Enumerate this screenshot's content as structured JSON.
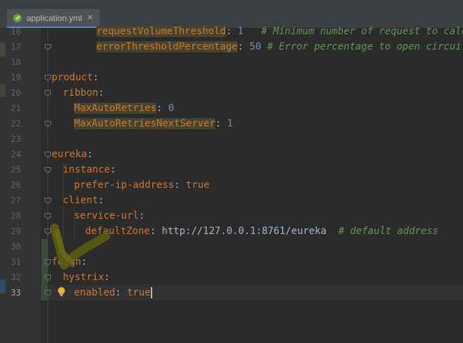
{
  "tab": {
    "filename": "application.yml",
    "close_glyph": "✕",
    "icon": "spring-leaf-icon"
  },
  "colors": {
    "key": "#cc7832",
    "comment": "#629755",
    "number": "#6897bb",
    "text": "#a9b7c6",
    "highlight": "#46432e"
  },
  "lines": [
    {
      "no": "16",
      "key": "requestVolumeThreshold",
      "sep": ": ",
      "value": "1",
      "comment": "   # Minimum number of request to calculo"
    },
    {
      "no": "17",
      "key": "errorThresholdPercentage",
      "sep": ": ",
      "value": "50",
      "comment": " # Error percentage to open circuit. d"
    },
    {
      "no": "18"
    },
    {
      "no": "19",
      "key": "product",
      "sep": ":"
    },
    {
      "no": "20",
      "key": "ribbon",
      "sep": ":"
    },
    {
      "no": "21",
      "key": "MaxAutoRetries",
      "sep": ": ",
      "value": "0"
    },
    {
      "no": "22",
      "key": "MaxAutoRetriesNextServer",
      "sep": ": ",
      "value": "1"
    },
    {
      "no": "23"
    },
    {
      "no": "24",
      "key": "eureka",
      "sep": ":"
    },
    {
      "no": "25",
      "key": "instance",
      "sep": ":"
    },
    {
      "no": "26",
      "key": "prefer-ip-address",
      "sep": ": ",
      "value": "true"
    },
    {
      "no": "27",
      "key": "client",
      "sep": ":"
    },
    {
      "no": "28",
      "key": "service-url",
      "sep": ":"
    },
    {
      "no": "29",
      "key": "defaultZone",
      "sep": ": ",
      "value": "http://127.0.0.1:8761/eureka",
      "comment": "  # default address"
    },
    {
      "no": "30"
    },
    {
      "no": "31",
      "key": "feign",
      "sep": ":"
    },
    {
      "no": "32",
      "key": "hystrix",
      "sep": ":"
    },
    {
      "no": "33",
      "key": "enabled",
      "sep": ": ",
      "value": "true"
    }
  ]
}
